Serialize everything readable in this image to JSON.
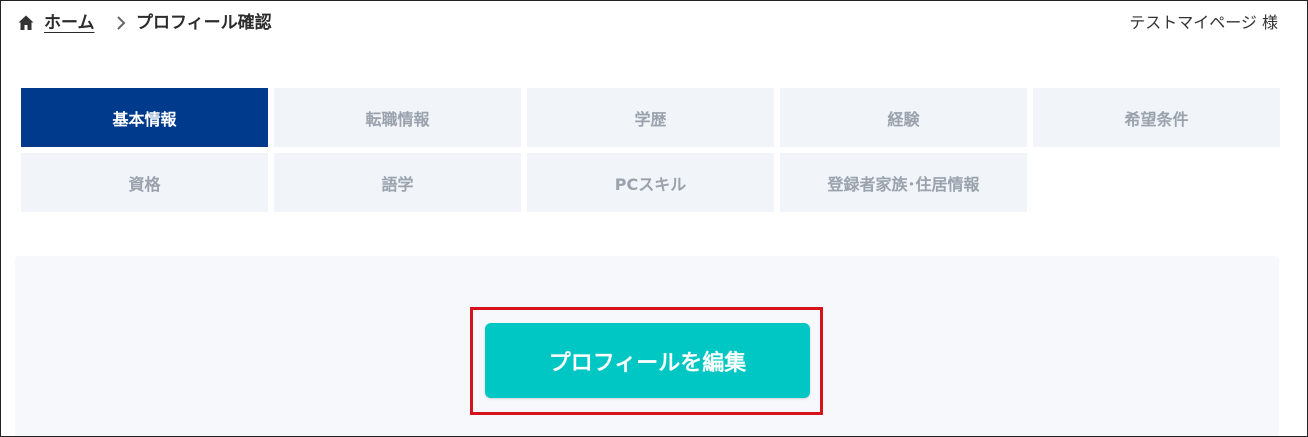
{
  "breadcrumb": {
    "home_label": "ホーム",
    "current_label": "プロフィール確認"
  },
  "user": {
    "name_label": "テストマイページ 様"
  },
  "tabs": [
    {
      "label": "基本情報",
      "active": true
    },
    {
      "label": "転職情報",
      "active": false
    },
    {
      "label": "学歴",
      "active": false
    },
    {
      "label": "経験",
      "active": false
    },
    {
      "label": "希望条件",
      "active": false
    },
    {
      "label": "資格",
      "active": false
    },
    {
      "label": "語学",
      "active": false
    },
    {
      "label": "PCスキル",
      "active": false
    },
    {
      "label": "登録者家族･住居情報",
      "active": false
    }
  ],
  "panel": {
    "edit_button_label": "プロフィールを編集"
  },
  "colors": {
    "active_tab": "#003a8c",
    "inactive_tab": "#f1f4f8",
    "inactive_tab_text": "#9aa2ad",
    "edit_button": "#00c7c4",
    "highlight_border": "#d6131b"
  },
  "icons": {
    "home": "home-icon",
    "separator": "chevron-right-icon"
  }
}
